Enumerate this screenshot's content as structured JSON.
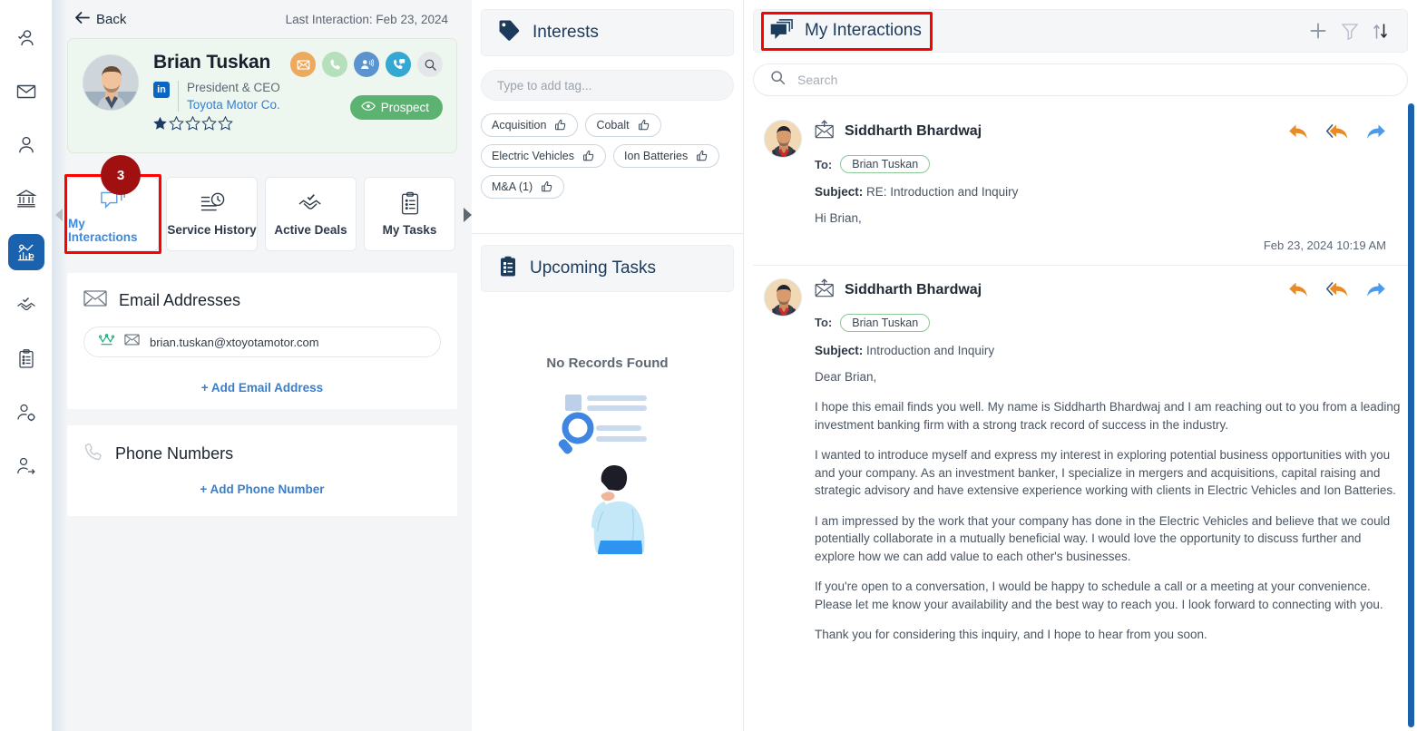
{
  "sidebar": {
    "items": [
      {
        "name": "contact-verified-icon",
        "label": "Contacts"
      },
      {
        "name": "mail-icon",
        "label": "Mail"
      },
      {
        "name": "person-icon",
        "label": "Leads"
      },
      {
        "name": "bank-icon",
        "label": "Accounts"
      },
      {
        "name": "analytics-gear-icon",
        "label": "Insights",
        "active": true
      },
      {
        "name": "handshake-check-icon",
        "label": "Deals"
      },
      {
        "name": "clipboard-list-icon",
        "label": "Tasks"
      },
      {
        "name": "user-settings-icon",
        "label": "User Settings"
      },
      {
        "name": "user-share-icon",
        "label": "Share"
      }
    ]
  },
  "contact": {
    "back_label": "Back",
    "last_interaction": "Last Interaction: Feb 23, 2024",
    "name": "Brian Tuskan",
    "title": "President & CEO",
    "company": "Toyota Motor Co.",
    "rating": 1,
    "rating_max": 5,
    "status_label": "Prospect",
    "linkedin_label": "in",
    "quick_actions": [
      {
        "name": "email-action-icon",
        "label": "Email",
        "color": "#eda95e"
      },
      {
        "name": "phone-action-icon",
        "label": "Call",
        "color": "#b6dfbc"
      },
      {
        "name": "meeting-action-icon",
        "label": "Meeting",
        "color": "#5b93cf"
      },
      {
        "name": "call-log-action-icon",
        "label": "Call Log",
        "color": "#34a8d2"
      },
      {
        "name": "search-action-icon",
        "label": "Search",
        "color": "#e4e7ea"
      }
    ],
    "tab_badge": "3",
    "tabs": [
      {
        "name": "my-interactions",
        "label": "My Interactions",
        "active": true
      },
      {
        "name": "service-history",
        "label": "Service History",
        "active": false
      },
      {
        "name": "active-deals",
        "label": "Active Deals",
        "active": false
      },
      {
        "name": "my-tasks",
        "label": "My Tasks",
        "active": false
      }
    ],
    "email_section": {
      "title": "Email Addresses",
      "primary_email": "brian.tuskan@xtoyotamotor.com",
      "add_label": "+ Add Email Address"
    },
    "phone_section": {
      "title": "Phone Numbers",
      "add_label": "+ Add Phone Number"
    }
  },
  "interests": {
    "title": "Interests",
    "tag_input_placeholder": "Type to add tag...",
    "tags": [
      {
        "label": "Acquisition"
      },
      {
        "label": "Cobalt"
      },
      {
        "label": "Electric Vehicles"
      },
      {
        "label": "Ion Batteries"
      },
      {
        "label": "M&A (1)"
      }
    ]
  },
  "upcoming_tasks": {
    "title": "Upcoming Tasks",
    "empty_label": "No Records Found"
  },
  "interactions": {
    "title": "My Interactions",
    "actions": [
      {
        "name": "add-icon",
        "label": "Add"
      },
      {
        "name": "filter-icon",
        "label": "Filter"
      },
      {
        "name": "sort-icon",
        "label": "Sort"
      }
    ],
    "search_placeholder": "Search",
    "messages": [
      {
        "sender": "Siddharth Bhardwaj",
        "to_label": "To:",
        "to": "Brian Tuskan",
        "subject_label": "Subject:",
        "subject": "RE: Introduction and Inquiry",
        "paragraphs": [
          "Hi Brian,"
        ],
        "date": "Feb 23, 2024 10:19 AM"
      },
      {
        "sender": "Siddharth Bhardwaj",
        "to_label": "To:",
        "to": "Brian Tuskan",
        "subject_label": "Subject:",
        "subject": "Introduction and Inquiry",
        "paragraphs": [
          "Dear Brian,",
          "I hope this email finds you well. My name is Siddharth Bhardwaj and I am reaching out to you from a leading investment banking firm with a strong track record of success in the industry.",
          "I wanted to introduce myself and express my interest in exploring potential business opportunities with you and your company. As an investment banker, I specialize in mergers and acquisitions, capital raising and strategic advisory and have extensive experience working with clients in Electric Vehicles and Ion Batteries.",
          "I am impressed by the work that your company has done in the Electric Vehicles and believe that we could potentially collaborate in a mutually beneficial way. I would love the opportunity to discuss further and explore how we can add value to each other's businesses.",
          "If you're open to a conversation, I would be happy to schedule a call or a meeting at your convenience. Please let me know your availability and the best way to reach you. I look forward to connecting with you.",
          "Thank you for considering this inquiry, and I hope to hear from you soon."
        ],
        "date": ""
      }
    ],
    "reply_actions": [
      {
        "name": "reply-icon",
        "label": "Reply"
      },
      {
        "name": "reply-all-icon",
        "label": "Reply All"
      },
      {
        "name": "forward-icon",
        "label": "Forward"
      }
    ]
  },
  "colors": {
    "accent": "#1a62ad",
    "highlight": "#ff0000",
    "prospect": "#5cb270",
    "badge": "#a01010",
    "link": "#3b7ec9"
  }
}
